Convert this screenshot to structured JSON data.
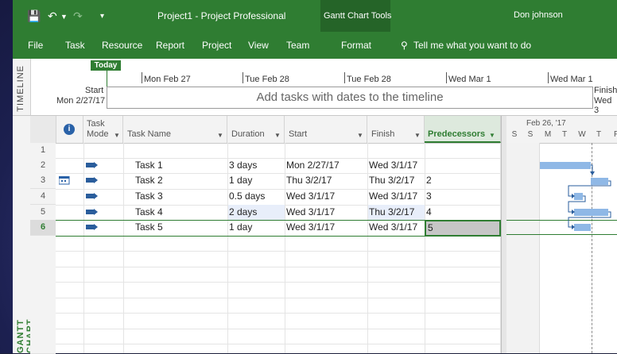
{
  "window": {
    "doc_title": "Project1  -  Project Professional",
    "context_header": "Gantt Chart Tools",
    "user": "Don johnson"
  },
  "ribbon": {
    "tabs": [
      "File",
      "Task",
      "Resource",
      "Report",
      "Project",
      "View",
      "Team",
      "Format"
    ],
    "tell_me": "Tell me what you want to do"
  },
  "timeline": {
    "side_label": "TIMELINE",
    "today": "Today",
    "start_label": "Start",
    "start_date": "Mon 2/27/17",
    "finish_label": "Finish",
    "finish_date": "Wed 3",
    "dates": [
      "Mon Feb 27",
      "Tue Feb 28",
      "Tue Feb 28",
      "Wed Mar 1",
      "Wed Mar 1"
    ],
    "placeholder": "Add tasks with dates to the timeline"
  },
  "gantt": {
    "side_label": "GANTT CHART",
    "columns": {
      "info": "i",
      "task_mode": "Task Mode",
      "task_name": "Task Name",
      "duration": "Duration",
      "start": "Start",
      "finish": "Finish",
      "predecessors": "Predecessors"
    },
    "rows": [
      {
        "num": "1",
        "name": "",
        "duration": "",
        "start": "",
        "finish": "",
        "pred": ""
      },
      {
        "num": "2",
        "name": "Task 1",
        "duration": "3 days",
        "start": "Mon 2/27/17",
        "finish": "Wed 3/1/17",
        "pred": ""
      },
      {
        "num": "3",
        "name": "Task 2",
        "duration": "1 day",
        "start": "Thu 3/2/17",
        "finish": "Thu 3/2/17",
        "pred": "2"
      },
      {
        "num": "4",
        "name": "Task 3",
        "duration": "0.5 days",
        "start": "Wed 3/1/17",
        "finish": "Wed 3/1/17",
        "pred": "3"
      },
      {
        "num": "5",
        "name": "Task 4",
        "duration": "2 days",
        "start": "Wed 3/1/17",
        "finish": "Thu 3/2/17",
        "pred": "4"
      },
      {
        "num": "6",
        "name": "Task 5",
        "duration": "1 day",
        "start": "Wed 3/1/17",
        "finish": "Wed 3/1/17",
        "pred": "5"
      }
    ],
    "chart": {
      "week_label": "Feb 26, '17",
      "days": [
        "S",
        "S",
        "M",
        "T",
        "W",
        "T",
        "F"
      ]
    }
  },
  "colors": {
    "ribbon_green": "#2f7d32",
    "bar_blue": "#8fb8e6"
  }
}
